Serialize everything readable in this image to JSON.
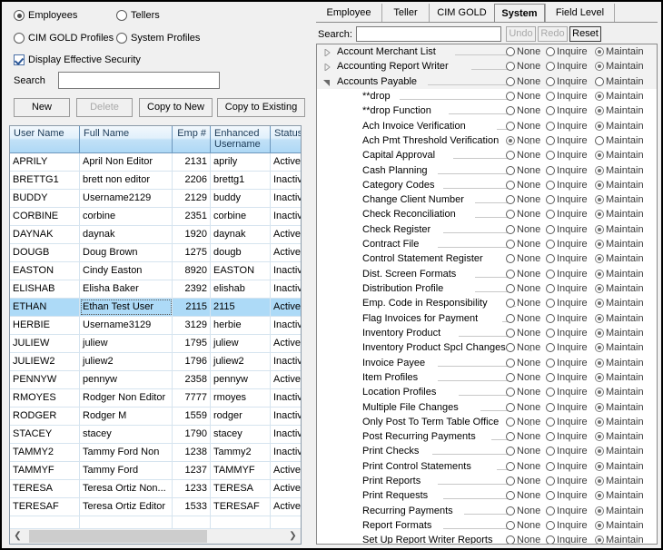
{
  "left_panel": {
    "type_options": [
      {
        "label": "Employees",
        "selected": true
      },
      {
        "label": "Tellers",
        "selected": false
      },
      {
        "label": "CIM GOLD Profiles",
        "selected": false
      },
      {
        "label": "System Profiles",
        "selected": false
      }
    ],
    "display_effective_security": {
      "label": "Display Effective Security",
      "checked": true
    },
    "search": {
      "label": "Search",
      "value": "",
      "placeholder": ""
    },
    "buttons": [
      {
        "label": "New",
        "enabled": true
      },
      {
        "label": "Delete",
        "enabled": false
      },
      {
        "label": "Copy to New",
        "enabled": true
      },
      {
        "label": "Copy to Existing",
        "enabled": true
      }
    ],
    "grid": {
      "columns": [
        "User Name",
        "Full Name",
        "Emp #",
        "Enhanced Username",
        "Status"
      ],
      "rows": [
        {
          "user_name": "APRILY",
          "full_name": "April Non Editor",
          "emp": "2131",
          "enhanced": "aprily",
          "status": "Active",
          "selected": false
        },
        {
          "user_name": "BRETTG1",
          "full_name": "brett non editor",
          "emp": "2206",
          "enhanced": "brettg1",
          "status": "Inactive",
          "selected": false
        },
        {
          "user_name": "BUDDY",
          "full_name": "Username2129",
          "emp": "2129",
          "enhanced": "buddy",
          "status": "Inactive",
          "selected": false
        },
        {
          "user_name": "CORBINE",
          "full_name": "corbine",
          "emp": "2351",
          "enhanced": "corbine",
          "status": "Inactive",
          "selected": false
        },
        {
          "user_name": "DAYNAK",
          "full_name": "daynak",
          "emp": "1920",
          "enhanced": "daynak",
          "status": "Active",
          "selected": false
        },
        {
          "user_name": "DOUGB",
          "full_name": "Doug Brown",
          "emp": "1275",
          "enhanced": "dougb",
          "status": "Active",
          "selected": false
        },
        {
          "user_name": "EASTON",
          "full_name": "Cindy Easton",
          "emp": "8920",
          "enhanced": "EASTON",
          "status": "Inactive",
          "selected": false
        },
        {
          "user_name": "ELISHAB",
          "full_name": "Elisha Baker",
          "emp": "2392",
          "enhanced": "elishab",
          "status": "Inactive",
          "selected": false
        },
        {
          "user_name": "ETHAN",
          "full_name": "Ethan Test User",
          "emp": "2115",
          "enhanced": "2115",
          "status": "Active",
          "selected": true
        },
        {
          "user_name": "HERBIE",
          "full_name": "Username3129",
          "emp": "3129",
          "enhanced": "herbie",
          "status": "Inactive",
          "selected": false
        },
        {
          "user_name": "JULIEW",
          "full_name": "juliew",
          "emp": "1795",
          "enhanced": "juliew",
          "status": "Active",
          "selected": false
        },
        {
          "user_name": "JULIEW2",
          "full_name": "juliew2",
          "emp": "1796",
          "enhanced": "juliew2",
          "status": "Inactive",
          "selected": false
        },
        {
          "user_name": "PENNYW",
          "full_name": "pennyw",
          "emp": "2358",
          "enhanced": "pennyw",
          "status": "Active",
          "selected": false
        },
        {
          "user_name": "RMOYES",
          "full_name": "Rodger Non Editor",
          "emp": "7777",
          "enhanced": "rmoyes",
          "status": "Inactive",
          "selected": false
        },
        {
          "user_name": "RODGER",
          "full_name": "Rodger M",
          "emp": "1559",
          "enhanced": "rodger",
          "status": "Inactive",
          "selected": false
        },
        {
          "user_name": "STACEY",
          "full_name": "stacey",
          "emp": "1790",
          "enhanced": "stacey",
          "status": "Inactive",
          "selected": false
        },
        {
          "user_name": "TAMMY2",
          "full_name": "Tammy Ford Non",
          "emp": "1238",
          "enhanced": "Tammy2",
          "status": "Inactive",
          "selected": false
        },
        {
          "user_name": "TAMMYF",
          "full_name": "Tammy Ford",
          "emp": "1237",
          "enhanced": "TAMMYF",
          "status": "Active",
          "selected": false
        },
        {
          "user_name": "TERESA",
          "full_name": "Teresa Ortiz Non...",
          "emp": "1233",
          "enhanced": "TERESA",
          "status": "Active",
          "selected": false
        },
        {
          "user_name": "TERESAF",
          "full_name": "Teresa Ortiz Editor",
          "emp": "1533",
          "enhanced": "TERESAF",
          "status": "Active",
          "selected": false
        },
        {
          "user_name": "",
          "full_name": "",
          "emp": "",
          "enhanced": "",
          "status": "",
          "selected": false
        },
        {
          "user_name": "",
          "full_name": "",
          "emp": "",
          "enhanced": "",
          "status": "",
          "selected": false
        }
      ],
      "hscrollbar": {
        "left_arrow": "❮",
        "right_arrow": "❯"
      }
    }
  },
  "right_panel": {
    "tabs": [
      {
        "label": "Employee",
        "active": false
      },
      {
        "label": "Teller",
        "active": false
      },
      {
        "label": "CIM GOLD",
        "active": false
      },
      {
        "label": "System",
        "active": true
      },
      {
        "label": "Field Level",
        "active": false
      }
    ],
    "search": {
      "label": "Search:",
      "value": "",
      "placeholder": ""
    },
    "actions": [
      {
        "label": "Undo",
        "enabled": false
      },
      {
        "label": "Redo",
        "enabled": false
      },
      {
        "label": "Reset",
        "enabled": true
      }
    ],
    "permission_options": [
      "None",
      "Inquire",
      "Maintain"
    ],
    "tree": [
      {
        "label": "Account Merchant List",
        "level": 0,
        "expander": "collapsed",
        "permission": "Maintain"
      },
      {
        "label": "Accounting Report Writer",
        "level": 0,
        "expander": "collapsed",
        "permission": "Maintain"
      },
      {
        "label": "Accounts Payable",
        "level": 0,
        "expander": "expanded",
        "permission": "none_selected"
      },
      {
        "label": "**drop",
        "level": 1,
        "expander": "none",
        "permission": "Maintain"
      },
      {
        "label": "**drop Function",
        "level": 1,
        "expander": "none",
        "permission": "Maintain"
      },
      {
        "label": "Ach Invoice Verification",
        "level": 1,
        "expander": "none",
        "permission": "Maintain"
      },
      {
        "label": "Ach Pmt Threshold Verification",
        "level": 1,
        "expander": "none",
        "permission": "None"
      },
      {
        "label": "Capital Approval",
        "level": 1,
        "expander": "none",
        "permission": "Maintain"
      },
      {
        "label": "Cash Planning",
        "level": 1,
        "expander": "none",
        "permission": "Maintain"
      },
      {
        "label": "Category Codes",
        "level": 1,
        "expander": "none",
        "permission": "Maintain"
      },
      {
        "label": "Change Client Number",
        "level": 1,
        "expander": "none",
        "permission": "Maintain"
      },
      {
        "label": "Check Reconciliation",
        "level": 1,
        "expander": "none",
        "permission": "Maintain"
      },
      {
        "label": "Check Register",
        "level": 1,
        "expander": "none",
        "permission": "Maintain"
      },
      {
        "label": "Contract File",
        "level": 1,
        "expander": "none",
        "permission": "Maintain"
      },
      {
        "label": "Control Statement Register",
        "level": 1,
        "expander": "none",
        "permission": "Maintain"
      },
      {
        "label": "Dist. Screen Formats",
        "level": 1,
        "expander": "none",
        "permission": "Maintain"
      },
      {
        "label": "Distribution Profile",
        "level": 1,
        "expander": "none",
        "permission": "Maintain"
      },
      {
        "label": "Emp. Code in Responsibility",
        "level": 1,
        "expander": "none",
        "permission": "Maintain"
      },
      {
        "label": "Flag Invoices for Payment",
        "level": 1,
        "expander": "none",
        "permission": "Maintain"
      },
      {
        "label": "Inventory Product",
        "level": 1,
        "expander": "none",
        "permission": "Maintain"
      },
      {
        "label": "Inventory Product Spcl Changes",
        "level": 1,
        "expander": "none",
        "permission": "Maintain"
      },
      {
        "label": "Invoice Payee",
        "level": 1,
        "expander": "none",
        "permission": "Maintain"
      },
      {
        "label": "Item Profiles",
        "level": 1,
        "expander": "none",
        "permission": "Maintain"
      },
      {
        "label": "Location Profiles",
        "level": 1,
        "expander": "none",
        "permission": "Maintain"
      },
      {
        "label": "Multiple File Changes",
        "level": 1,
        "expander": "none",
        "permission": "Maintain"
      },
      {
        "label": "Only Post To Term Table Office",
        "level": 1,
        "expander": "none",
        "permission": "Maintain"
      },
      {
        "label": "Post Recurring Payments",
        "level": 1,
        "expander": "none",
        "permission": "Maintain"
      },
      {
        "label": "Print Checks",
        "level": 1,
        "expander": "none",
        "permission": "Maintain"
      },
      {
        "label": "Print Control Statements",
        "level": 1,
        "expander": "none",
        "permission": "Maintain"
      },
      {
        "label": "Print Reports",
        "level": 1,
        "expander": "none",
        "permission": "Maintain"
      },
      {
        "label": "Print Requests",
        "level": 1,
        "expander": "none",
        "permission": "Maintain"
      },
      {
        "label": "Recurring Payments",
        "level": 1,
        "expander": "none",
        "permission": "Maintain"
      },
      {
        "label": "Report Formats",
        "level": 1,
        "expander": "none",
        "permission": "Maintain"
      },
      {
        "label": "Set Up Report Writer Reports",
        "level": 1,
        "expander": "none",
        "permission": "Maintain"
      }
    ]
  }
}
